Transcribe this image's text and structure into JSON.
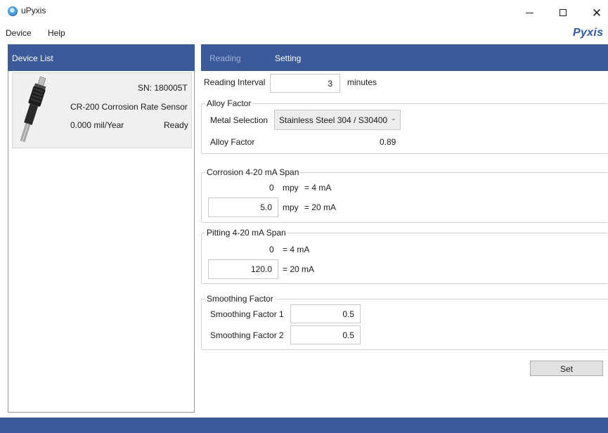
{
  "window": {
    "title": "uPyxis",
    "icons": {
      "app": "app-icon",
      "minimize": "minimize-icon",
      "maximize": "maximize-icon",
      "close": "close-icon"
    }
  },
  "menu": {
    "items": [
      "Device",
      "Help"
    ]
  },
  "brand": {
    "logo_text": "Pyxis",
    "color": "#2d5aa6"
  },
  "colors": {
    "header_bg": "#3c5a99",
    "tab_inactive": "#9fb0d2",
    "tab_active": "#ffffff",
    "card_bg": "#f0f0f0"
  },
  "device_list": {
    "title": "Device List",
    "devices": [
      {
        "image": "sensor-probe-image",
        "serial": "SN: 180005T",
        "model": "CR-200 Corrosion Rate Sensor",
        "reading": "0.000 mil/Year",
        "status": "Ready"
      }
    ]
  },
  "tabs": [
    {
      "label": "Reading",
      "active": false
    },
    {
      "label": "Setting",
      "active": true
    }
  ],
  "settings": {
    "reading_interval": {
      "label": "Reading Interval",
      "value": "3",
      "unit": "minutes"
    },
    "alloy": {
      "group_title": "Alloy Factor",
      "metal_label": "Metal Selection",
      "metal_value": "Stainless Steel 304 / S30400",
      "factor_label": "Alloy Factor",
      "factor_value": "0.89"
    },
    "corrosion_span": {
      "group_title": "Corrosion 4-20 mA Span",
      "low_value": "0",
      "low_unit": "mpy",
      "low_eq": "= 4 mA",
      "high_value": "5.0",
      "high_unit": "mpy",
      "high_eq": "= 20 mA"
    },
    "pitting_span": {
      "group_title": "Pitting 4-20 mA Span",
      "low_value": "0",
      "low_eq": "= 4 mA",
      "high_value": "120.0",
      "high_eq": "= 20 mA"
    },
    "smoothing": {
      "group_title": "Smoothing Factor",
      "f1_label": "Smoothing Factor 1",
      "f1_value": "0.5",
      "f2_label": "Smoothing Factor 2",
      "f2_value": "0.5"
    },
    "set_button": "Set"
  }
}
